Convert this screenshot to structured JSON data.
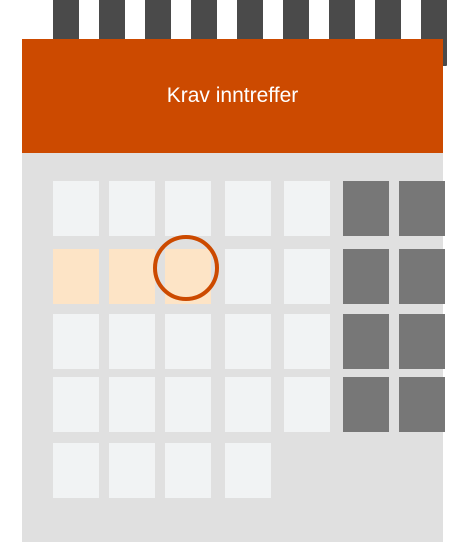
{
  "calendar": {
    "title": "Krav inntreffer",
    "colors": {
      "header": "#cc4a00",
      "rings": "#4a4a4a",
      "body": "#e0e0e0",
      "day": "#f1f3f4",
      "weekend": "#777777",
      "highlight": "#fde4c6",
      "marker": "#cc4a00"
    },
    "weeks": [
      [
        "day",
        "day",
        "day",
        "day",
        "day",
        "weekend",
        "weekend"
      ],
      [
        "highlight",
        "highlight",
        "highlight",
        "day",
        "day",
        "weekend",
        "weekend"
      ],
      [
        "day",
        "day",
        "day",
        "day",
        "day",
        "weekend",
        "weekend"
      ],
      [
        "day",
        "day",
        "day",
        "day",
        "day",
        "weekend",
        "weekend"
      ],
      [
        "day",
        "day",
        "day",
        "day"
      ]
    ],
    "marked_day": {
      "week": 2,
      "weekday": 3
    }
  }
}
